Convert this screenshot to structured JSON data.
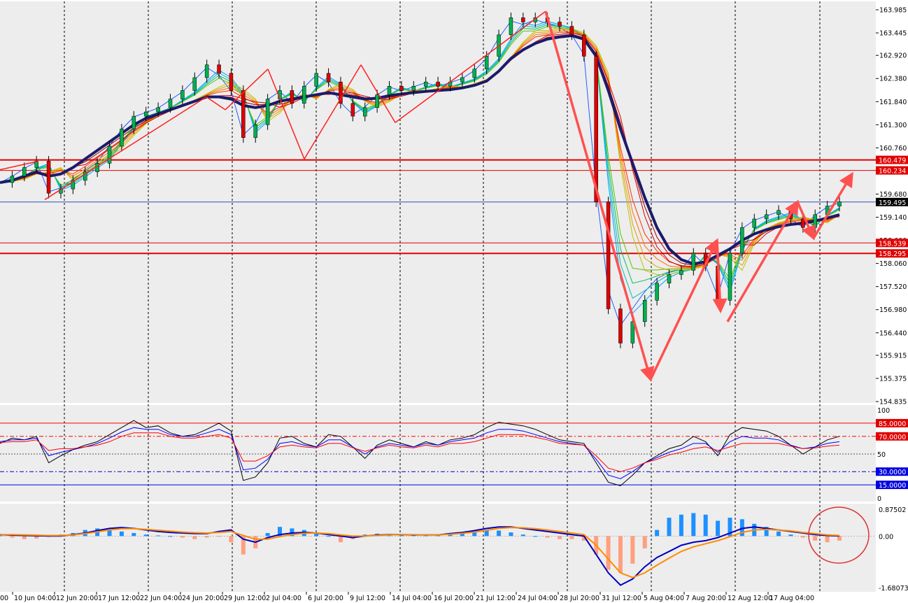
{
  "chart_data": {
    "type": "candlestick",
    "instrument_note": "",
    "colors": {
      "background": "#ededed",
      "grid": "#000000",
      "bull": "#00b050",
      "bear": "#e00000",
      "trend_line": "#ff2020",
      "arrow": "#ff5050",
      "slow_ma": "#1b1b6b",
      "price_tag_red": "#e00000",
      "price_tag_black": "#000000",
      "rsi_fast": "#000000",
      "rsi_mid": "#0000ff",
      "rsi_slow": "#ff0000",
      "macd_line": "#0000c0",
      "signal_line": "#ff8c00",
      "hist_pos": "#1e90ff",
      "hist_neg": "#ff9f80",
      "circle": "#e03030"
    },
    "price_axis": {
      "ylim": [
        154.835,
        163.985
      ],
      "ticks": [
        "163.985",
        "163.445",
        "162.920",
        "162.380",
        "161.840",
        "161.300",
        "160.760",
        "160.220",
        "159.680",
        "159.140",
        "158.600",
        "158.060",
        "157.520",
        "156.980",
        "156.440",
        "155.915",
        "155.375",
        "154.835"
      ]
    },
    "time_axis": {
      "labels": [
        "10 Jun 04:00",
        "12 Jun 20:00",
        "17 Jun 12:00",
        "22 Jun 04:00",
        "24 Jun 20:00",
        "29 Jun 12:00",
        "2 Jul 04:00",
        "6 Jul 20:00",
        "9 Jul 12:00",
        "14 Jul 04:00",
        "16 Jul 20:00",
        "21 Jul 12:00",
        "24 Jul 04:00",
        "28 Jul 20:00",
        "31 Jul 12:00",
        "5 Aug 04:00",
        "7 Aug 20:00",
        "12 Aug 12:00",
        "17 Aug 04:00"
      ],
      "first_label": "00"
    },
    "horizontal_levels": [
      {
        "price": 160.479,
        "label": "160.479",
        "color": "#e00000",
        "width": 2
      },
      {
        "price": 160.234,
        "label": "160.234",
        "color": "#e00000",
        "width": 1
      },
      {
        "price": 159.495,
        "label": "159.495",
        "color": "#3050c0",
        "width": 1,
        "tag_color": "#000000"
      },
      {
        "price": 158.539,
        "label": "158.539",
        "color": "#e00000",
        "width": 1
      },
      {
        "price": 158.295,
        "label": "158.295",
        "color": "#e00000",
        "width": 2
      }
    ],
    "close_series": [
      159.95,
      160.1,
      160.3,
      160.45,
      159.7,
      159.8,
      160.0,
      160.2,
      160.4,
      160.8,
      161.2,
      161.5,
      161.6,
      161.7,
      161.9,
      162.1,
      162.4,
      162.7,
      162.5,
      162.1,
      161.0,
      161.3,
      161.9,
      162.1,
      161.8,
      162.2,
      162.5,
      162.3,
      161.8,
      161.5,
      161.7,
      162.0,
      162.2,
      162.1,
      162.2,
      162.3,
      162.2,
      162.3,
      162.4,
      162.6,
      162.9,
      163.4,
      163.8,
      163.7,
      163.8,
      163.7,
      163.6,
      163.4,
      162.9,
      159.5,
      157.0,
      156.2,
      156.7,
      157.2,
      157.6,
      157.8,
      157.9,
      158.3,
      158.0,
      157.2,
      158.3,
      158.9,
      159.1,
      159.2,
      159.3,
      159.1,
      158.9,
      159.2,
      159.4,
      159.5
    ],
    "ma_series": [
      159.95,
      160.0,
      160.1,
      160.2,
      160.1,
      160.15,
      160.3,
      160.5,
      160.7,
      160.9,
      161.1,
      161.3,
      161.45,
      161.55,
      161.65,
      161.75,
      161.85,
      161.95,
      161.95,
      161.9,
      161.75,
      161.7,
      161.75,
      161.85,
      161.9,
      161.95,
      162.0,
      162.05,
      162.0,
      161.95,
      161.9,
      161.92,
      161.98,
      162.02,
      162.05,
      162.08,
      162.1,
      162.12,
      162.16,
      162.22,
      162.32,
      162.55,
      162.85,
      163.05,
      163.2,
      163.3,
      163.35,
      163.38,
      163.3,
      162.9,
      162.1,
      161.2,
      160.4,
      159.6,
      158.9,
      158.4,
      158.15,
      158.05,
      158.1,
      158.25,
      158.4,
      158.6,
      158.75,
      158.85,
      158.92,
      158.97,
      159.0,
      159.05,
      159.12,
      159.2
    ],
    "trend_segments": [
      {
        "from": [
          0.0,
          160.25
        ],
        "to": [
          55.0,
          160.45
        ]
      },
      {
        "from": [
          64.0,
          159.55
        ],
        "to": [
          295.0,
          161.95
        ]
      },
      {
        "from": [
          295.0,
          161.95
        ],
        "to": [
          322.0,
          161.65
        ]
      },
      {
        "from": [
          322.0,
          161.65
        ],
        "to": [
          383.0,
          162.6
        ]
      },
      {
        "from": [
          383.0,
          162.6
        ],
        "to": [
          435.0,
          160.5
        ]
      },
      {
        "from": [
          435.0,
          160.5
        ],
        "to": [
          516.0,
          162.7
        ]
      },
      {
        "from": [
          516.0,
          162.7
        ],
        "to": [
          565.0,
          161.35
        ]
      },
      {
        "from": [
          565.0,
          161.35
        ],
        "to": [
          780.0,
          163.95
        ]
      }
    ],
    "arrows": [
      {
        "from": [
          780.0,
          163.95
        ],
        "to": [
          930.0,
          155.35
        ]
      },
      {
        "from": [
          930.0,
          155.35
        ],
        "to": [
          1025.0,
          158.6
        ]
      },
      {
        "from": [
          1025.0,
          158.6
        ],
        "to": [
          1030.0,
          156.95
        ]
      },
      {
        "from": [
          1040.0,
          156.7
        ],
        "to": [
          1140.0,
          159.5
        ]
      },
      {
        "from": [
          1140.0,
          159.5
        ],
        "to": [
          1163.0,
          158.65
        ]
      },
      {
        "from": [
          1163.0,
          158.65
        ],
        "to": [
          1218.0,
          160.15
        ]
      }
    ],
    "rsi": {
      "levels": [
        "85.0000",
        "70.0000",
        "30.0000",
        "15.0000"
      ],
      "scale_labels": [
        "100",
        "50",
        "0"
      ],
      "fast": [
        62,
        68,
        66,
        70,
        40,
        48,
        55,
        60,
        64,
        72,
        80,
        88,
        80,
        82,
        74,
        70,
        72,
        78,
        85,
        76,
        20,
        24,
        40,
        68,
        70,
        62,
        58,
        72,
        70,
        58,
        45,
        60,
        66,
        62,
        58,
        64,
        60,
        66,
        68,
        72,
        80,
        86,
        84,
        82,
        78,
        72,
        66,
        64,
        62,
        40,
        18,
        14,
        26,
        40,
        48,
        56,
        60,
        70,
        64,
        48,
        72,
        80,
        78,
        76,
        70,
        60,
        50,
        58,
        66,
        70
      ],
      "mid": [
        64,
        66,
        66,
        68,
        48,
        52,
        55,
        58,
        62,
        68,
        75,
        80,
        78,
        78,
        72,
        70,
        70,
        74,
        78,
        72,
        32,
        34,
        44,
        62,
        64,
        60,
        58,
        66,
        66,
        58,
        50,
        58,
        62,
        60,
        58,
        62,
        60,
        64,
        66,
        68,
        74,
        78,
        78,
        76,
        72,
        68,
        64,
        62,
        60,
        44,
        26,
        22,
        30,
        40,
        46,
        52,
        56,
        62,
        62,
        52,
        64,
        70,
        68,
        68,
        66,
        60,
        56,
        58,
        62,
        64
      ],
      "slow": [
        63,
        64,
        64,
        66,
        54,
        56,
        56,
        58,
        60,
        64,
        70,
        74,
        74,
        74,
        70,
        68,
        68,
        70,
        72,
        68,
        42,
        42,
        48,
        58,
        60,
        58,
        57,
        62,
        62,
        57,
        53,
        57,
        60,
        58,
        57,
        60,
        58,
        62,
        62,
        64,
        68,
        72,
        72,
        72,
        69,
        66,
        62,
        61,
        60,
        48,
        34,
        30,
        34,
        40,
        44,
        49,
        52,
        56,
        58,
        54,
        58,
        62,
        62,
        62,
        62,
        59,
        56,
        57,
        59,
        60
      ]
    },
    "macd": {
      "scale_labels": [
        "0.87502",
        "0.00",
        "-1.68073"
      ],
      "hist": [
        0.02,
        -0.05,
        -0.1,
        -0.08,
        0.0,
        0.05,
        0.1,
        0.2,
        0.25,
        0.2,
        0.15,
        0.1,
        0.05,
        0.02,
        0.0,
        -0.05,
        -0.1,
        -0.05,
        -0.02,
        -0.2,
        -0.6,
        -0.4,
        0.1,
        0.3,
        0.25,
        0.2,
        0.1,
        0.0,
        -0.2,
        -0.1,
        0.05,
        0.08,
        0.05,
        0.04,
        0.03,
        0.02,
        0.02,
        0.05,
        0.1,
        0.15,
        0.2,
        0.18,
        0.12,
        0.05,
        0.0,
        -0.05,
        -0.1,
        -0.1,
        -0.15,
        -0.6,
        -1.1,
        -1.2,
        -0.9,
        -0.4,
        0.2,
        0.6,
        0.7,
        0.75,
        0.7,
        0.5,
        0.6,
        0.55,
        0.4,
        0.3,
        0.15,
        0.05,
        -0.05,
        -0.15,
        -0.2,
        -0.15
      ],
      "line": [
        0.05,
        0.03,
        0.02,
        0.01,
        0.0,
        0.0,
        0.05,
        0.1,
        0.18,
        0.25,
        0.28,
        0.25,
        0.2,
        0.15,
        0.12,
        0.1,
        0.08,
        0.08,
        0.15,
        0.2,
        -0.1,
        -0.2,
        -0.05,
        0.05,
        0.1,
        0.12,
        0.1,
        0.05,
        0.0,
        -0.05,
        0.0,
        0.03,
        0.05,
        0.05,
        0.04,
        0.04,
        0.04,
        0.08,
        0.12,
        0.18,
        0.25,
        0.3,
        0.3,
        0.25,
        0.2,
        0.15,
        0.1,
        0.05,
        0.0,
        -0.6,
        -1.2,
        -1.6,
        -1.4,
        -1.0,
        -0.7,
        -0.5,
        -0.3,
        -0.2,
        -0.15,
        -0.05,
        0.1,
        0.25,
        0.3,
        0.25,
        0.2,
        0.15,
        0.1,
        0.05,
        0.02,
        0.0
      ],
      "signal": [
        0.05,
        0.05,
        0.04,
        0.03,
        0.02,
        0.02,
        0.04,
        0.08,
        0.14,
        0.2,
        0.24,
        0.24,
        0.22,
        0.19,
        0.16,
        0.13,
        0.11,
        0.1,
        0.12,
        0.15,
        0.02,
        -0.1,
        -0.1,
        -0.02,
        0.05,
        0.09,
        0.1,
        0.08,
        0.04,
        0.0,
        0.0,
        0.02,
        0.04,
        0.05,
        0.05,
        0.04,
        0.04,
        0.06,
        0.09,
        0.13,
        0.19,
        0.25,
        0.28,
        0.27,
        0.24,
        0.2,
        0.15,
        0.1,
        0.05,
        -0.3,
        -0.75,
        -1.2,
        -1.35,
        -1.2,
        -0.95,
        -0.72,
        -0.5,
        -0.35,
        -0.25,
        -0.15,
        -0.02,
        0.12,
        0.2,
        0.22,
        0.2,
        0.17,
        0.12,
        0.08,
        0.04,
        0.02
      ]
    }
  }
}
